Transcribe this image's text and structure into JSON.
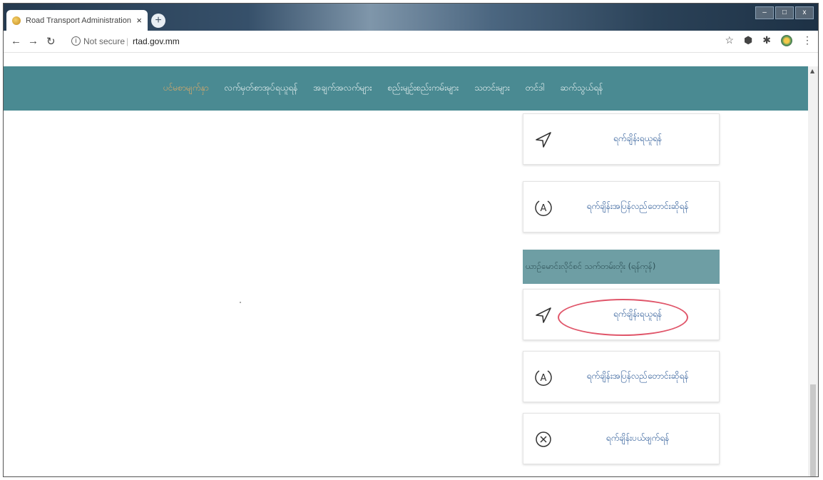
{
  "browser": {
    "tab_title": "Road Transport Administration D",
    "tab_close": "×",
    "new_tab": "+",
    "security_text": "Not secure",
    "url": "rtad.gov.mm",
    "window_controls": [
      "–",
      "□",
      "x"
    ]
  },
  "nav": {
    "items": [
      "ပင်မစာမျက်နှာ",
      "လက်မှတ်စာအုပ်ရယူရန်",
      "အချက်အလက်များ",
      "စည်းမျဉ်းစည်းကမ်းများ",
      "သတင်းများ",
      "တင်ဒါ",
      "ဆက်သွယ်ရန်"
    ],
    "active_color": "#d9a96a",
    "bar_color": "#4a8a92"
  },
  "cards": [
    {
      "label": "ရက်ချိန်းရယူရန်",
      "icon": "send-icon"
    },
    {
      "label": "ရက်ချိန်းအပြန်လည်တောင်းဆိုရန်",
      "icon": "a-circle-icon"
    },
    {
      "label": "ရက်ချိန်းရယူရန်",
      "icon": "send-icon",
      "highlighted": true
    },
    {
      "label": "ရက်ချိန်းအပြန်လည်တောင်းဆိုရန်",
      "icon": "a-circle-icon"
    },
    {
      "label": "ရက်ချိန်းပယ်ဖျက်ရန်",
      "icon": "close-circle-icon"
    }
  ],
  "section_header": "ယာဉ်မောင်းလိုင်စင် သက်တမ်းတိုး (ရန်ကုန်)",
  "icon_text": {
    "a_letter": "A"
  },
  "colors": {
    "highlight": "#e0566a",
    "label_text": "#2c5a97"
  }
}
